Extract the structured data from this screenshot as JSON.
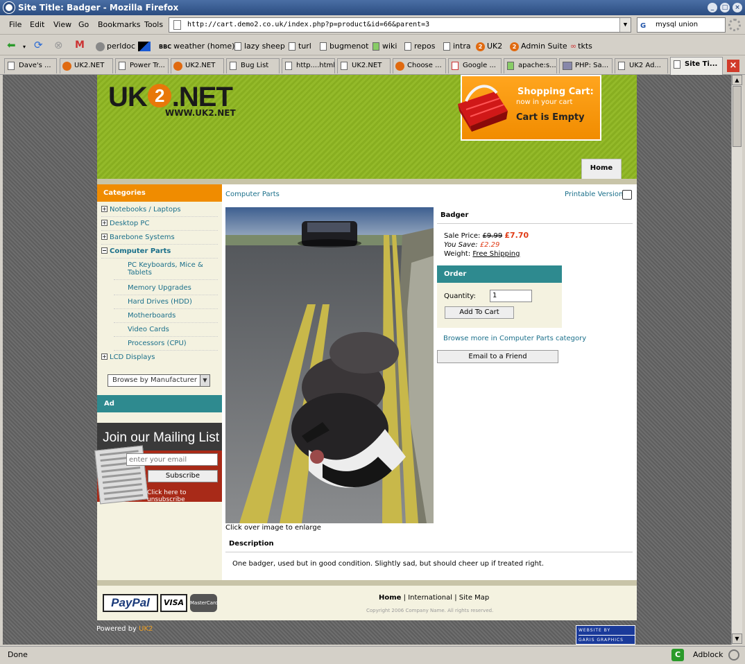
{
  "window": {
    "title": "Site Title: Badger - Mozilla Firefox"
  },
  "menu": [
    "File",
    "Edit",
    "View",
    "Go",
    "Bookmarks",
    "Tools"
  ],
  "url": "http://cart.demo2.co.uk/index.php?p=product&id=66&parent=3",
  "search_value": "mysql union",
  "bookmarks": [
    "perldoc",
    "weather (home)",
    "lazy sheep",
    "turl",
    "bugmenot",
    "wiki",
    "repos",
    "intra",
    "UK2",
    "Admin Suite",
    "tkts"
  ],
  "tabs": [
    "Dave's ...",
    "UK2.NET",
    "Power Tr...",
    "UK2.NET",
    "Bug List",
    "http....html",
    "UK2.NET",
    "Choose ...",
    "Google ...",
    "apache:s...",
    "PHP: Sa...",
    "UK2 Ad...",
    "Site Ti..."
  ],
  "status": {
    "text": "Done",
    "adblock": "Adblock"
  },
  "site": {
    "logo": "UK2.NET",
    "logo_parts": {
      "a": "UK",
      "b": "2",
      "c": ".NET"
    },
    "logo_url": "WWW.UK2.NET",
    "cart": {
      "title": "Shopping Cart:",
      "subtitle": "now in your cart",
      "status": "Cart is Empty"
    },
    "home_tab": "Home"
  },
  "sidebar": {
    "categories_title": "Categories",
    "categories": [
      {
        "label": "Notebooks / Laptops",
        "expand": "+"
      },
      {
        "label": "Desktop PC",
        "expand": "+"
      },
      {
        "label": "Barebone Systems",
        "expand": "+"
      },
      {
        "label": "Computer Parts",
        "expand": "−"
      },
      {
        "label": "PC Keyboards, Mice & Tablets"
      },
      {
        "label": "Memory Upgrades"
      },
      {
        "label": "Hard Drives (HDD)"
      },
      {
        "label": "Motherboards"
      },
      {
        "label": "Video Cards"
      },
      {
        "label": "Processors (CPU)"
      },
      {
        "label": "LCD Displays",
        "expand": "+"
      }
    ],
    "manufacturer_select": "Browse by Manufacturer",
    "ad_title": "Ad",
    "mailing": {
      "title": "Join our Mailing List",
      "placeholder": "enter your email",
      "subscribe": "Subscribe",
      "unsubscribe": "Click here to unsubscribe"
    }
  },
  "product": {
    "breadcrumb": "Computer Parts",
    "printable": "Printable Version",
    "name": "Badger",
    "sale_label": "Sale Price:",
    "old_price": "£9.99",
    "new_price": "£7.70",
    "save_label": "You Save:",
    "save_value": "£2.29",
    "weight_label": "Weight:",
    "weight_value": "Free Shipping",
    "order_title": "Order",
    "quantity_label": "Quantity:",
    "quantity_value": "1",
    "add_to_cart": "Add To Cart",
    "browse_more": "Browse more in Computer Parts category",
    "email_friend": "Email to a Friend",
    "caption": "Click over image to enlarge",
    "desc_title": "Description",
    "description": "One badger, used but in good condition. Slightly sad, but should cheer up if treated right."
  },
  "footer": {
    "paypal": "PayPal",
    "visa": "VISA",
    "mastercard": "MasterCard",
    "link_home": "Home",
    "link_international": "International",
    "link_sitemap": "Site Map",
    "separator": "|",
    "copyright": "Copyright 2006 Company Name. All rights reserved.",
    "powered_prefix": "Powered by",
    "powered_brand": "UK2",
    "website_by_1": "WEBSITE BY",
    "website_by_2": "GARIS GRAPHICS"
  }
}
